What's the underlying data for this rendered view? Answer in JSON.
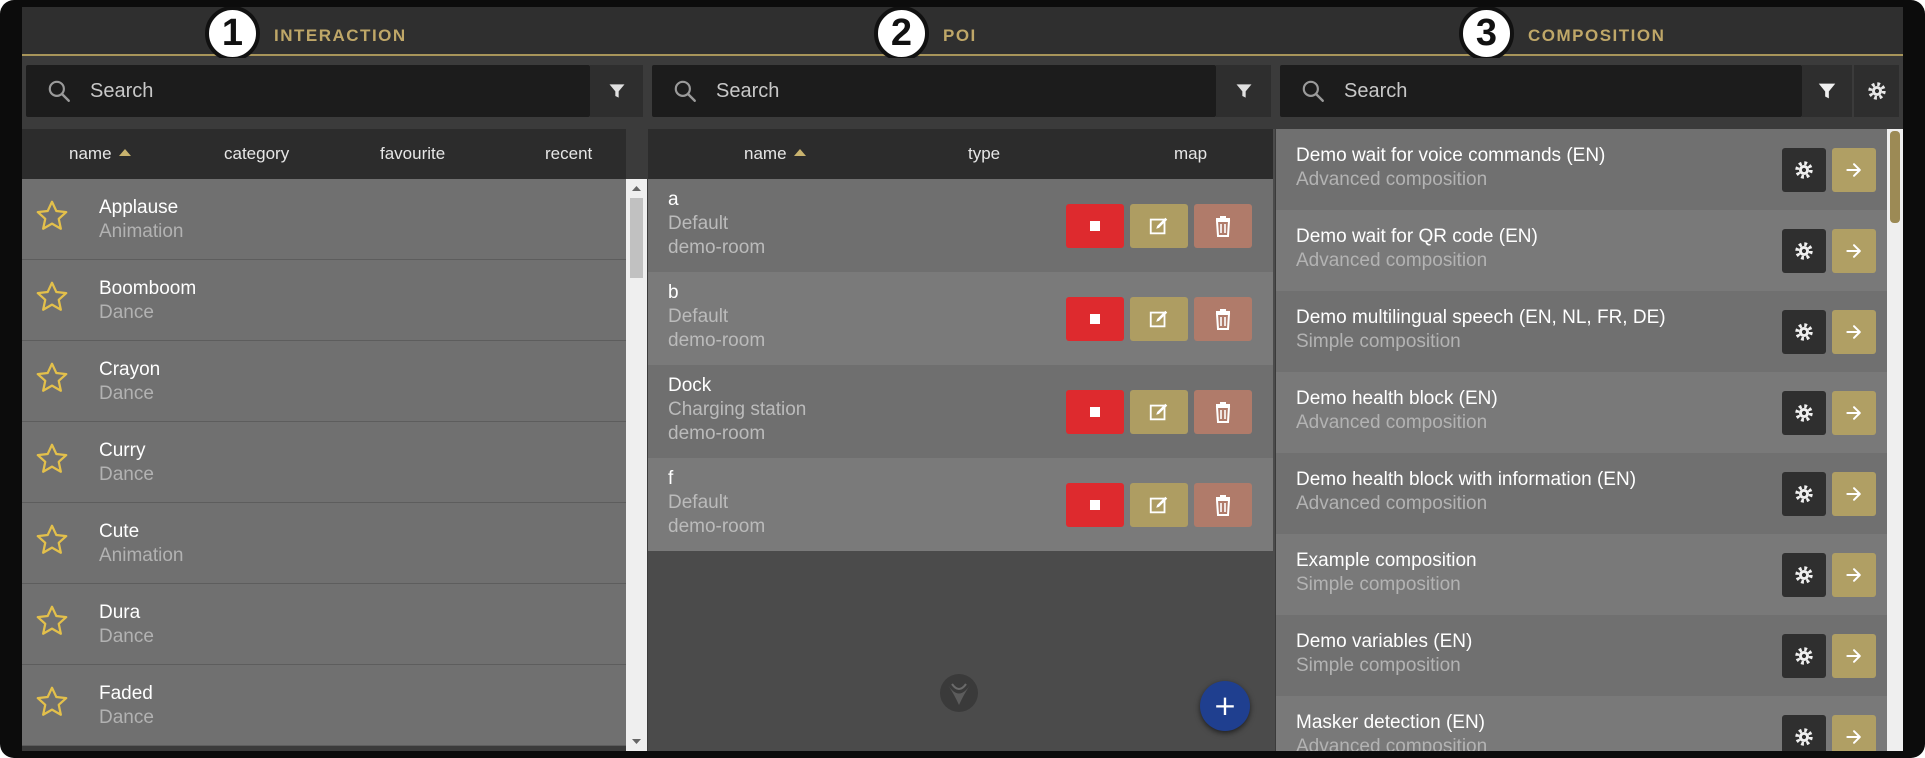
{
  "header": {
    "sections": [
      {
        "number": "1",
        "title": "INTERACTION"
      },
      {
        "number": "2",
        "title": "POI"
      },
      {
        "number": "3",
        "title": "COMPOSITION"
      }
    ]
  },
  "interaction": {
    "search_placeholder": "Search",
    "columns": {
      "name": "name",
      "category": "category",
      "favourite": "favourite",
      "recent": "recent"
    },
    "items": [
      {
        "name": "Applause",
        "category": "Animation"
      },
      {
        "name": "Boomboom",
        "category": "Dance"
      },
      {
        "name": "Crayon",
        "category": "Dance"
      },
      {
        "name": "Curry",
        "category": "Dance"
      },
      {
        "name": "Cute",
        "category": "Animation"
      },
      {
        "name": "Dura",
        "category": "Dance"
      },
      {
        "name": "Faded",
        "category": "Dance"
      }
    ]
  },
  "poi": {
    "search_placeholder": "Search",
    "columns": {
      "name": "name",
      "type": "type",
      "map": "map"
    },
    "items": [
      {
        "name": "a",
        "type": "Default",
        "map": "demo-room"
      },
      {
        "name": "b",
        "type": "Default",
        "map": "demo-room"
      },
      {
        "name": "Dock",
        "type": "Charging station",
        "map": "demo-room"
      },
      {
        "name": "f",
        "type": "Default",
        "map": "demo-room"
      }
    ],
    "add_label": "+"
  },
  "composition": {
    "search_placeholder": "Search",
    "items": [
      {
        "name": "Demo wait for voice commands (EN)",
        "type": "Advanced composition"
      },
      {
        "name": "Demo wait for QR code (EN)",
        "type": "Advanced composition"
      },
      {
        "name": "Demo multilingual speech (EN, NL, FR, DE)",
        "type": "Simple composition"
      },
      {
        "name": "Demo health block (EN)",
        "type": "Advanced composition"
      },
      {
        "name": "Demo health block with information (EN)",
        "type": "Advanced composition"
      },
      {
        "name": "Example composition",
        "type": "Simple composition"
      },
      {
        "name": "Demo variables (EN)",
        "type": "Simple composition"
      },
      {
        "name": "Masker detection (EN)",
        "type": "Advanced composition"
      }
    ]
  },
  "colors": {
    "accent_gold": "#bfa768",
    "stop_red": "#de2a2e",
    "fab_blue": "#1f3f8f"
  }
}
